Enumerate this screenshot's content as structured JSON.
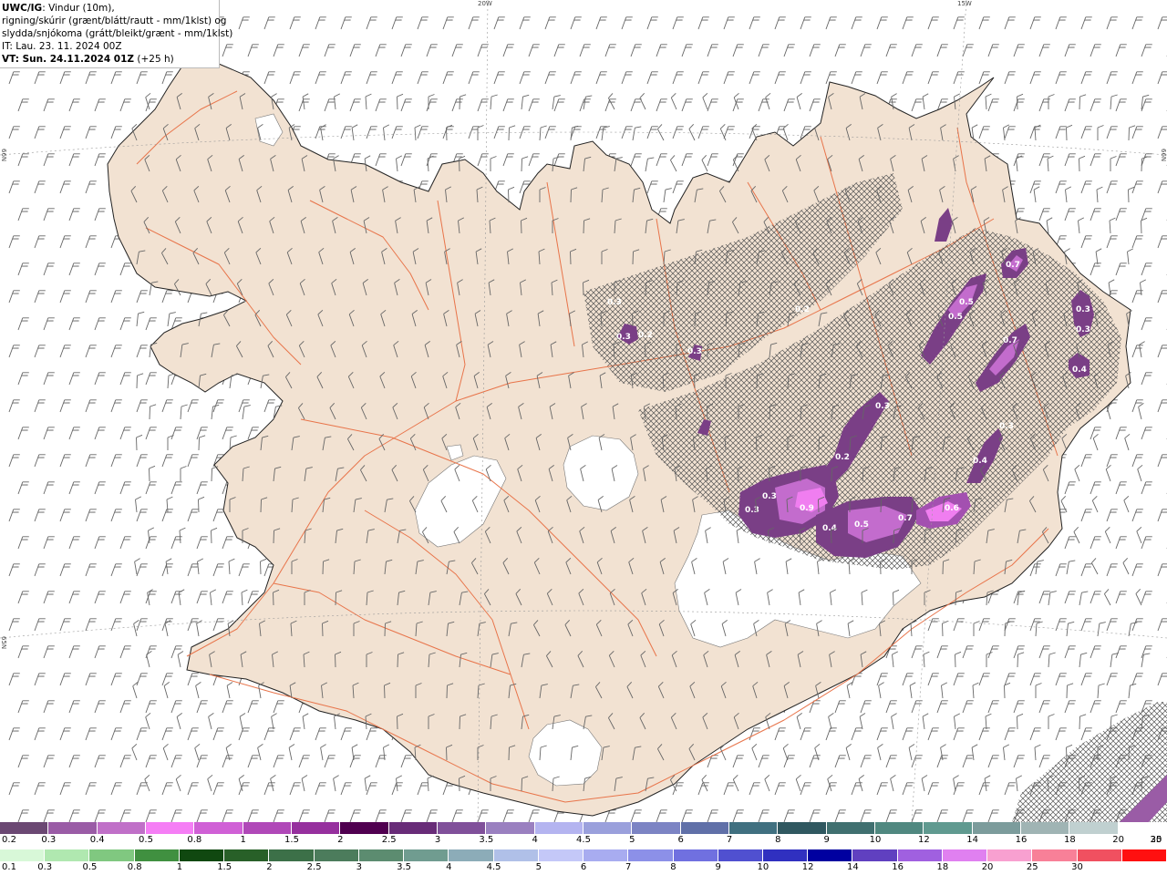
{
  "info": {
    "line1_bold": "UWC/IG",
    "line1_rest": ": Vindur (10m),",
    "line2": "rigning/skúrir (grænt/blátt/rautt - mm/1klst) og",
    "line3": "slydda/snjókoma (grátt/bleikt/grænt - mm/1klst)",
    "line4": "IT: Lau. 23. 11. 2024 00Z",
    "line5_bold": "VT: Sun. 24.11.2024 01Z",
    "line5_rest": " (+25 h)"
  },
  "grid_labels": {
    "lon_20w": "20W",
    "lon_15w": "15W",
    "lat_66n_left": "66N",
    "lat_66n_right": "66N",
    "lat_65n_left": "65N"
  },
  "colors": {
    "land": "#f2e2d2",
    "roads": "#e8744a",
    "glacier": "#ffffff",
    "sea": "#ffffff",
    "barb": "#666666"
  },
  "precip_labels": [
    {
      "id": "p1",
      "text": "0.3"
    },
    {
      "id": "p2",
      "text": "0.3"
    },
    {
      "id": "p3",
      "text": "0.2"
    },
    {
      "id": "p4",
      "text": "0.3"
    },
    {
      "id": "p5",
      "text": "0.2"
    },
    {
      "id": "p6",
      "text": "0.5"
    },
    {
      "id": "p7",
      "text": "0.5"
    },
    {
      "id": "p8",
      "text": "0.7"
    },
    {
      "id": "p9",
      "text": "0.3"
    },
    {
      "id": "p10",
      "text": "0.3"
    },
    {
      "id": "p11",
      "text": "0.7"
    },
    {
      "id": "p12",
      "text": "0.4"
    },
    {
      "id": "p13",
      "text": "0.3"
    },
    {
      "id": "p14",
      "text": "0.2"
    },
    {
      "id": "p15",
      "text": "0.3"
    },
    {
      "id": "p16",
      "text": "0.3"
    },
    {
      "id": "p17",
      "text": "0.9"
    },
    {
      "id": "p18",
      "text": "0.4"
    },
    {
      "id": "p19",
      "text": "0.5"
    },
    {
      "id": "p20",
      "text": "0.7"
    },
    {
      "id": "p21",
      "text": "0.6"
    },
    {
      "id": "p22",
      "text": "0.4"
    },
    {
      "id": "p23",
      "text": "0.3"
    }
  ],
  "legend_snow": {
    "colors": [
      "#6b4873",
      "#9a5ca6",
      "#c070c8",
      "#f57ef5",
      "#d060d6",
      "#b048b8",
      "#96309e",
      "#500050",
      "#682c78",
      "#80509a",
      "#9a80c0",
      "#b4b4f0",
      "#9aa0dc",
      "#7c84c4",
      "#6070a8",
      "#407080",
      "#305860",
      "#407070",
      "#508880",
      "#609a90",
      "#7c9c9c",
      "#a0b4b4",
      "#c0d0d0",
      "#ffffff"
    ],
    "labels": [
      "0.2",
      "0.3",
      "0.4",
      "0.5",
      "0.8",
      "1",
      "1.5",
      "2",
      "2.5",
      "3",
      "3.5",
      "4",
      "4.5",
      "5",
      "6",
      "7",
      "8",
      "9",
      "10",
      "12",
      "14",
      "16",
      "18",
      "20",
      "25",
      "30"
    ]
  },
  "legend_rain": {
    "colors": [
      "#d8f8d8",
      "#b0e8b0",
      "#80c880",
      "#409040",
      "#104810",
      "#286028",
      "#3c7048",
      "#4c7c5c",
      "#5c8c70",
      "#709c90",
      "#8cacb8",
      "#b0c0e8",
      "#c4c8f8",
      "#a8acf0",
      "#8c90e8",
      "#7070e0",
      "#5050d0",
      "#3030c0",
      "#0000a0",
      "#6040c0",
      "#a060e0",
      "#e080f0",
      "#f8a0d0",
      "#f88098",
      "#f05060",
      "#ff1010"
    ],
    "labels": [
      "0.1",
      "0.3",
      "0.5",
      "0.8",
      "1",
      "1.5",
      "2",
      "2.5",
      "3",
      "3.5",
      "4",
      "4.5",
      "5",
      "6",
      "7",
      "8",
      "9",
      "10",
      "12",
      "14",
      "16",
      "18",
      "20",
      "25",
      "30"
    ]
  }
}
